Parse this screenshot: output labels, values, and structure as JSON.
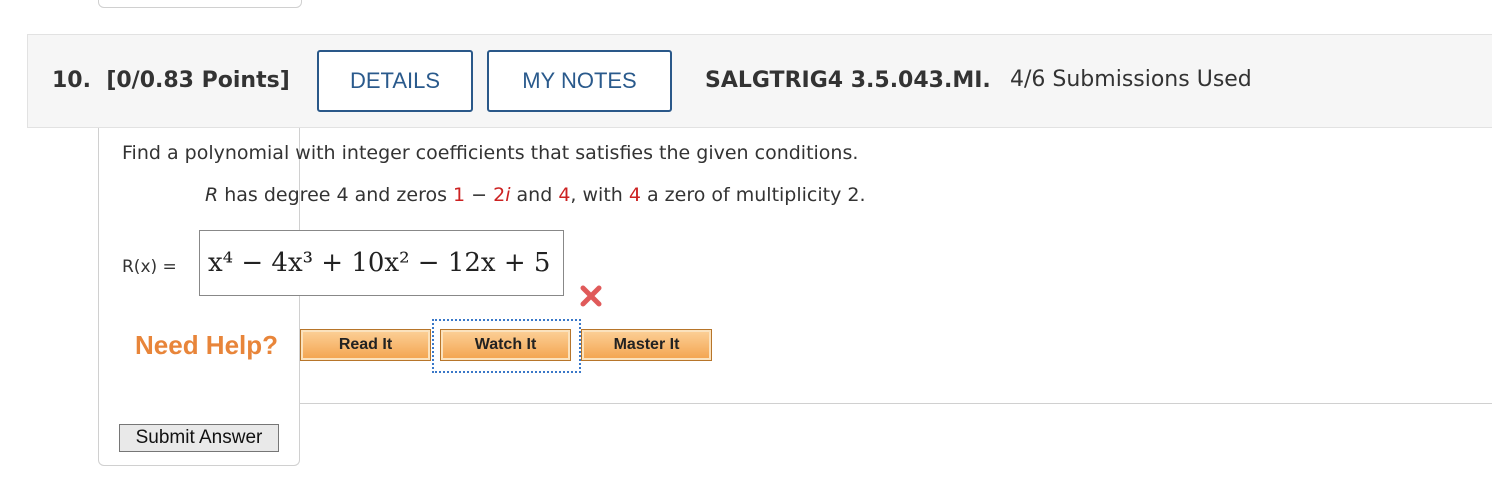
{
  "question": {
    "number_label": "10.",
    "points_label": "[0/0.83 Points]",
    "details_label": "DETAILS",
    "my_notes_label": "MY NOTES",
    "code": "SALGTRIG4 3.5.043.MI.",
    "submissions": "4/6 Submissions Used"
  },
  "problem": {
    "prompt": "Find a polynomial with integer coefficients that satisfies the given conditions.",
    "condition": {
      "var": "R",
      "text1": " has degree 4 and zeros ",
      "zero1_real": "1",
      "zero1_op": " − ",
      "zero1_imag": "2",
      "zero1_unit": "i",
      "text2": " and ",
      "zero2": "4",
      "text3": ", with ",
      "zero3": "4",
      "text4": " a zero of multiplicity 2."
    }
  },
  "answer": {
    "label": "R(x) =",
    "value": "x⁴ − 4x³ + 10x² − 12x + 5",
    "status_icon": "red-x-icon",
    "status_color": "#e05a5a"
  },
  "help": {
    "title": "Need Help?",
    "read_it": "Read It",
    "watch_it": "Watch It",
    "master_it": "Master It",
    "accent_color": "#e8853a"
  },
  "submit_label": "Submit Answer"
}
